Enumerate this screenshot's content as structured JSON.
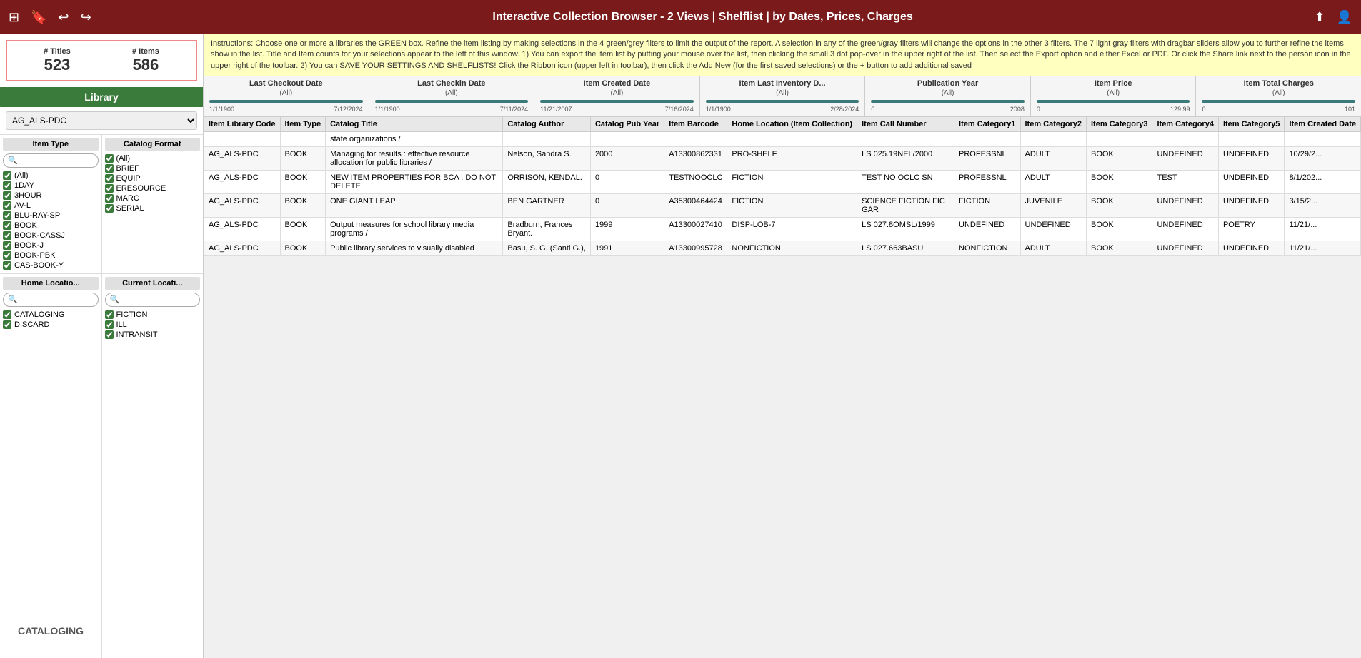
{
  "app": {
    "title": "Interactive Collection Browser - 2 Views | Shelflist | by Dates, Prices, Charges"
  },
  "toolbar": {
    "icons": [
      "grid-icon",
      "bookmark-icon",
      "undo-icon",
      "redo-icon",
      "share-icon",
      "user-icon"
    ]
  },
  "stats": {
    "titles_label": "# Titles",
    "titles_value": "523",
    "items_label": "# Items",
    "items_value": "586"
  },
  "instructions": "Instructions: Choose one or more a libraries the GREEN box.  Refine the item listing by making selections in the 4 green/grey filters to limit the output of the report.  A selection in any of the green/gray filters will change the options in the other 3 filters.  The 7 light gray filters with dragbar sliders allow you to further refine the items show in the list.  Title and Item counts for your selections appear to the left of this window.    1) You can export the item list by putting your mouse over the list, then clicking the small 3 dot pop-over in the upper right of the list.  Then select the Export option and either Excel or PDF.  Or click the Share link next to the person icon in the upper right of the toolbar.   2) You can SAVE YOUR SETTINGS AND SHELFLISTS!  Click the Ribbon icon (upper left in toolbar), then click the Add New (for the first saved selections) or the + button to add additional saved",
  "library": {
    "label": "Library",
    "selected": "AG_ALS-PDC"
  },
  "sliders": [
    {
      "title": "Last Checkout Date",
      "all": "(All)",
      "min": "1/1/1900",
      "max": "7/12/2024"
    },
    {
      "title": "Last Checkin Date",
      "all": "(All)",
      "min": "1/1/1900",
      "max": "7/11/2024"
    },
    {
      "title": "Item Created Date",
      "all": "(All)",
      "min": "11/21/2007",
      "max": "7/16/2024"
    },
    {
      "title": "Item Last Inventory D...",
      "all": "(All)",
      "min": "1/1/1900",
      "max": "2/28/2024"
    },
    {
      "title": "Publication Year",
      "all": "(All)",
      "min": "0",
      "max": "2008"
    },
    {
      "title": "Item Price",
      "all": "(All)",
      "min": "0",
      "max": "129.99"
    },
    {
      "title": "Item Total Charges",
      "all": "(All)",
      "min": "0",
      "max": "101"
    }
  ],
  "item_type_filter": {
    "title": "Item Type",
    "items": [
      {
        "label": "(All)",
        "checked": true
      },
      {
        "label": "1DAY",
        "checked": true
      },
      {
        "label": "3HOUR",
        "checked": true
      },
      {
        "label": "AV-L",
        "checked": true
      },
      {
        "label": "BLU-RAY-SP",
        "checked": true
      },
      {
        "label": "BOOK",
        "checked": true
      },
      {
        "label": "BOOK-CASSJ",
        "checked": true
      },
      {
        "label": "BOOK-J",
        "checked": true
      },
      {
        "label": "BOOK-PBK",
        "checked": true
      },
      {
        "label": "CAS-BOOK-Y",
        "checked": true
      }
    ]
  },
  "catalog_format_filter": {
    "title": "Catalog Format",
    "items": [
      {
        "label": "(All)",
        "checked": true
      },
      {
        "label": "BRIEF",
        "checked": true
      },
      {
        "label": "EQUIP",
        "checked": true
      },
      {
        "label": "ERESOURCE",
        "checked": true
      },
      {
        "label": "MARC",
        "checked": true
      },
      {
        "label": "SERIAL",
        "checked": true
      }
    ]
  },
  "home_location_filter": {
    "title": "Home Locatio...",
    "items": [
      {
        "label": "CATALOGING",
        "checked": true
      },
      {
        "label": "DISCARD",
        "checked": true
      }
    ]
  },
  "current_location_filter": {
    "title": "Current Locati...",
    "items": [
      {
        "label": "FICTION",
        "checked": true
      },
      {
        "label": "ILL",
        "checked": true
      },
      {
        "label": "INTRANSIT",
        "checked": true
      }
    ]
  },
  "table": {
    "columns": [
      "Item Library Code",
      "Item Type",
      "Catalog Title",
      "Catalog Author",
      "Catalog Pub Year",
      "Item Barcode",
      "Home Location (Item Collection)",
      "Item Call Number",
      "Item Category1",
      "Item Category2",
      "Item Category3",
      "Item Category4",
      "Item Category5",
      "Item Created Date"
    ],
    "rows": [
      {
        "library_code": "",
        "item_type": "",
        "catalog_title": "state organizations /",
        "catalog_author": "",
        "pub_year": "",
        "barcode": "",
        "home_location": "",
        "call_number": "",
        "cat1": "",
        "cat2": "",
        "cat3": "",
        "cat4": "",
        "cat5": "",
        "created_date": ""
      },
      {
        "library_code": "AG_ALS-PDC",
        "item_type": "BOOK",
        "catalog_title": "Managing for results : effective resource allocation for public libraries /",
        "catalog_author": "Nelson, Sandra S.",
        "pub_year": "2000",
        "barcode": "A13300862331",
        "home_location": "PRO-SHELF",
        "call_number": "LS 025.19NEL/2000",
        "cat1": "PROFESSNL",
        "cat2": "ADULT",
        "cat3": "BOOK",
        "cat4": "UNDEFINED",
        "cat5": "UNDEFINED",
        "created_date": "10/29/2..."
      },
      {
        "library_code": "AG_ALS-PDC",
        "item_type": "BOOK",
        "catalog_title": "NEW ITEM PROPERTIES FOR BCA : DO NOT DELETE",
        "catalog_author": "ORRISON, KENDAL.",
        "pub_year": "0",
        "barcode": "TESTNOOCLC",
        "home_location": "FICTION",
        "call_number": "TEST NO OCLC SN",
        "cat1": "PROFESSNL",
        "cat2": "ADULT",
        "cat3": "BOOK",
        "cat4": "TEST",
        "cat5": "UNDEFINED",
        "created_date": "8/1/202..."
      },
      {
        "library_code": "AG_ALS-PDC",
        "item_type": "BOOK",
        "catalog_title": "ONE GIANT LEAP",
        "catalog_author": "BEN GARTNER",
        "pub_year": "0",
        "barcode": "A35300464424",
        "home_location": "FICTION",
        "call_number": "SCIENCE FICTION FIC GAR",
        "cat1": "FICTION",
        "cat2": "JUVENILE",
        "cat3": "BOOK",
        "cat4": "UNDEFINED",
        "cat5": "UNDEFINED",
        "created_date": "3/15/2..."
      },
      {
        "library_code": "AG_ALS-PDC",
        "item_type": "BOOK",
        "catalog_title": "Output measures for school library media programs /",
        "catalog_author": "Bradburn, Frances Bryant.",
        "pub_year": "1999",
        "barcode": "A13300027410",
        "home_location": "DISP-LOB-7",
        "call_number": "LS 027.8OMSL/1999",
        "cat1": "UNDEFINED",
        "cat2": "UNDEFINED",
        "cat3": "BOOK",
        "cat4": "UNDEFINED",
        "cat5": "POETRY",
        "created_date": "11/21/..."
      },
      {
        "library_code": "AG_ALS-PDC",
        "item_type": "BOOK",
        "catalog_title": "Public library services to visually disabled",
        "catalog_author": "Basu, S. G. (Santi G.),",
        "pub_year": "1991",
        "barcode": "A13300995728",
        "home_location": "NONFICTION",
        "call_number": "LS 027.663BASU",
        "cat1": "NONFICTION",
        "cat2": "ADULT",
        "cat3": "BOOK",
        "cat4": "UNDEFINED",
        "cat5": "UNDEFINED",
        "created_date": "11/21/..."
      }
    ]
  },
  "bottom_label": "CATALOGING"
}
